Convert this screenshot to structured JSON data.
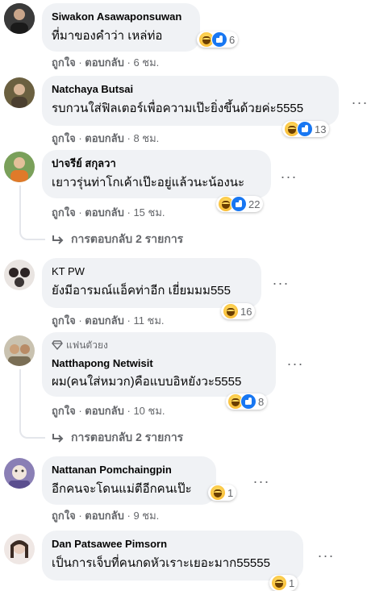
{
  "comments": [
    {
      "name": "Siwakon Asawaponsuwan",
      "text": "ที่มาของคำว่า เหล่ท่อ",
      "reaction_count": "6",
      "like_label": "ถูกใจ",
      "reply_label": "ตอบกลับ",
      "time": "6 ชม.",
      "avatar_color": "#2b2b2b"
    },
    {
      "name": "Natchaya Butsai",
      "text": "รบกวนใส่ฟิลเตอร์เพื่อความเป๊ะยิ่งขึ้นด้วยค่ะ5555",
      "reaction_count": "13",
      "like_label": "ถูกใจ",
      "reply_label": "ตอบกลับ",
      "time": "8 ชม.",
      "avatar_color": "#6b6040"
    },
    {
      "name": "ปาจรีย์ สกุลวา",
      "text": "เยาวรุ่นท่าโกเค้าเป๊ะอยู่แล้วนะน้องนะ",
      "reaction_count": "22",
      "like_label": "ถูกใจ",
      "reply_label": "ตอบกลับ",
      "time": "15 ชม.",
      "replies_label": "การตอบกลับ 2 รายการ",
      "avatar_color": "#e07a2a"
    },
    {
      "name": "KT PW",
      "text": "ยังมีอารมณ์แอ็คท่าอีก เยี่ยมมม555",
      "reaction_count": "16",
      "like_label": "ถูกใจ",
      "reply_label": "ตอบกลับ",
      "time": "11 ชม.",
      "avatar_color": "#3a3434"
    },
    {
      "badge": "แฟนตัวยง",
      "name": "Natthapong Netwisit",
      "text": "ผม(คนใส่หมวก)คือแบบอิหยังวะ5555",
      "reaction_count": "8",
      "like_label": "ถูกใจ",
      "reply_label": "ตอบกลับ",
      "time": "10 ชม.",
      "replies_label": "การตอบกลับ 2 รายการ",
      "avatar_color": "#7a6e55"
    },
    {
      "name": "Nattanan Pomchaingpin",
      "text": "อีกคนจะโดนแม่ตีอีกคนเป๊ะ",
      "reaction_count": "1",
      "like_label": "ถูกใจ",
      "reply_label": "ตอบกลับ",
      "time": "9 ชม.",
      "avatar_color": "#8a7fb5"
    },
    {
      "name": "Dan Patsawee Pimsorn",
      "text": "เป็นการเจ็บที่คนกดหัวเราะเยอะมาก55555",
      "reaction_count": "1",
      "avatar_color": "#d9b8b0"
    }
  ],
  "icons": {
    "more": "more-horizontal-icon",
    "reply_arrow": "reply-arrow-icon",
    "haha": "haha-reaction-icon",
    "like": "like-reaction-icon",
    "badge": "diamond-badge-icon"
  }
}
